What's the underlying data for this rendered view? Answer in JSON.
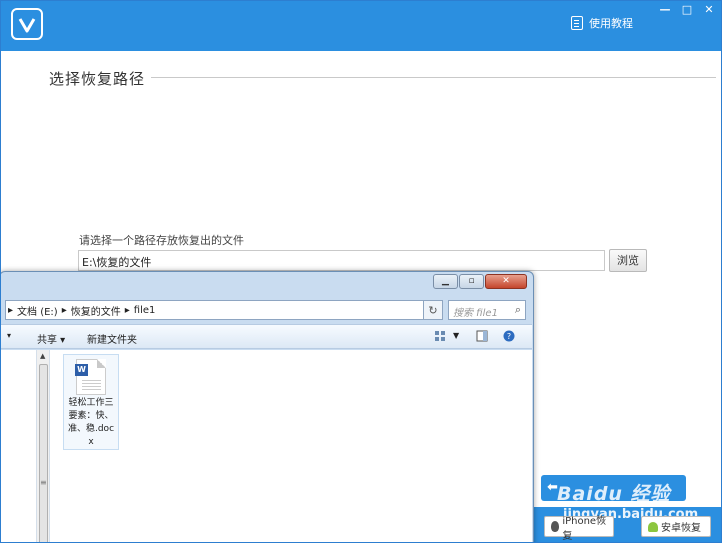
{
  "app": {
    "tutorial_label": "使用教程",
    "window_controls": [
      "—",
      "□",
      "✕"
    ]
  },
  "section": {
    "title": "选择恢复路径"
  },
  "path": {
    "label": "请选择一个路径存放恢复出的文件",
    "value": "E:\\恢复的文件",
    "browse_label": "浏览"
  },
  "explorer": {
    "breadcrumb": [
      "文档 (E:)",
      "恢复的文件",
      "file1"
    ],
    "search_placeholder": "搜索 file1",
    "toolbar": {
      "share_label": "共享 ▾",
      "new_folder_label": "新建文件夹"
    },
    "files": [
      {
        "name": "轻松工作三要素：快、准、稳.docx",
        "icon": "word-doc-icon"
      }
    ]
  },
  "footer": {
    "iphone_label": "iPhone恢复",
    "android_label": "安卓恢复"
  },
  "watermark": {
    "brand": "Baidu 经验",
    "url": "jingyan.baidu.com"
  },
  "colors": {
    "primary": "#2b8fe0",
    "explorer_chrome": "#c9dcf0"
  }
}
